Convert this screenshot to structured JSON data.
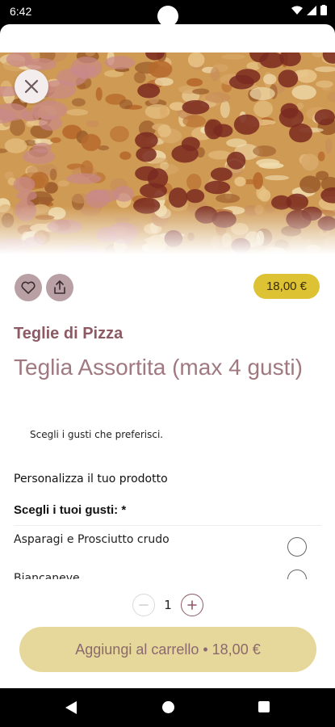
{
  "status_bar": {
    "time": "6:42"
  },
  "product": {
    "category": "Teglie di Pizza",
    "title": "Teglia Assortita (max 4 gusti)",
    "price": "18,00 €",
    "description": "Scegli i gusti che preferisci."
  },
  "customization": {
    "heading": "Personalizza il tuo prodotto",
    "group_title": "Scegli i tuoi gusti: *",
    "options": [
      {
        "label": "Asparagi e Prosciutto crudo"
      },
      {
        "label": "Biancaneve"
      }
    ]
  },
  "quantity": {
    "value": "1"
  },
  "cart_button": {
    "label": "Aggiungi al carrello • 18,00 €"
  },
  "icons": {
    "close": "close-icon",
    "favorite": "heart-icon",
    "share": "share-icon",
    "minus": "minus-icon",
    "plus": "plus-icon"
  },
  "colors": {
    "accent": "#8d5a64",
    "price_badge": "#ddc233",
    "cart_button": "#e6d79a"
  }
}
